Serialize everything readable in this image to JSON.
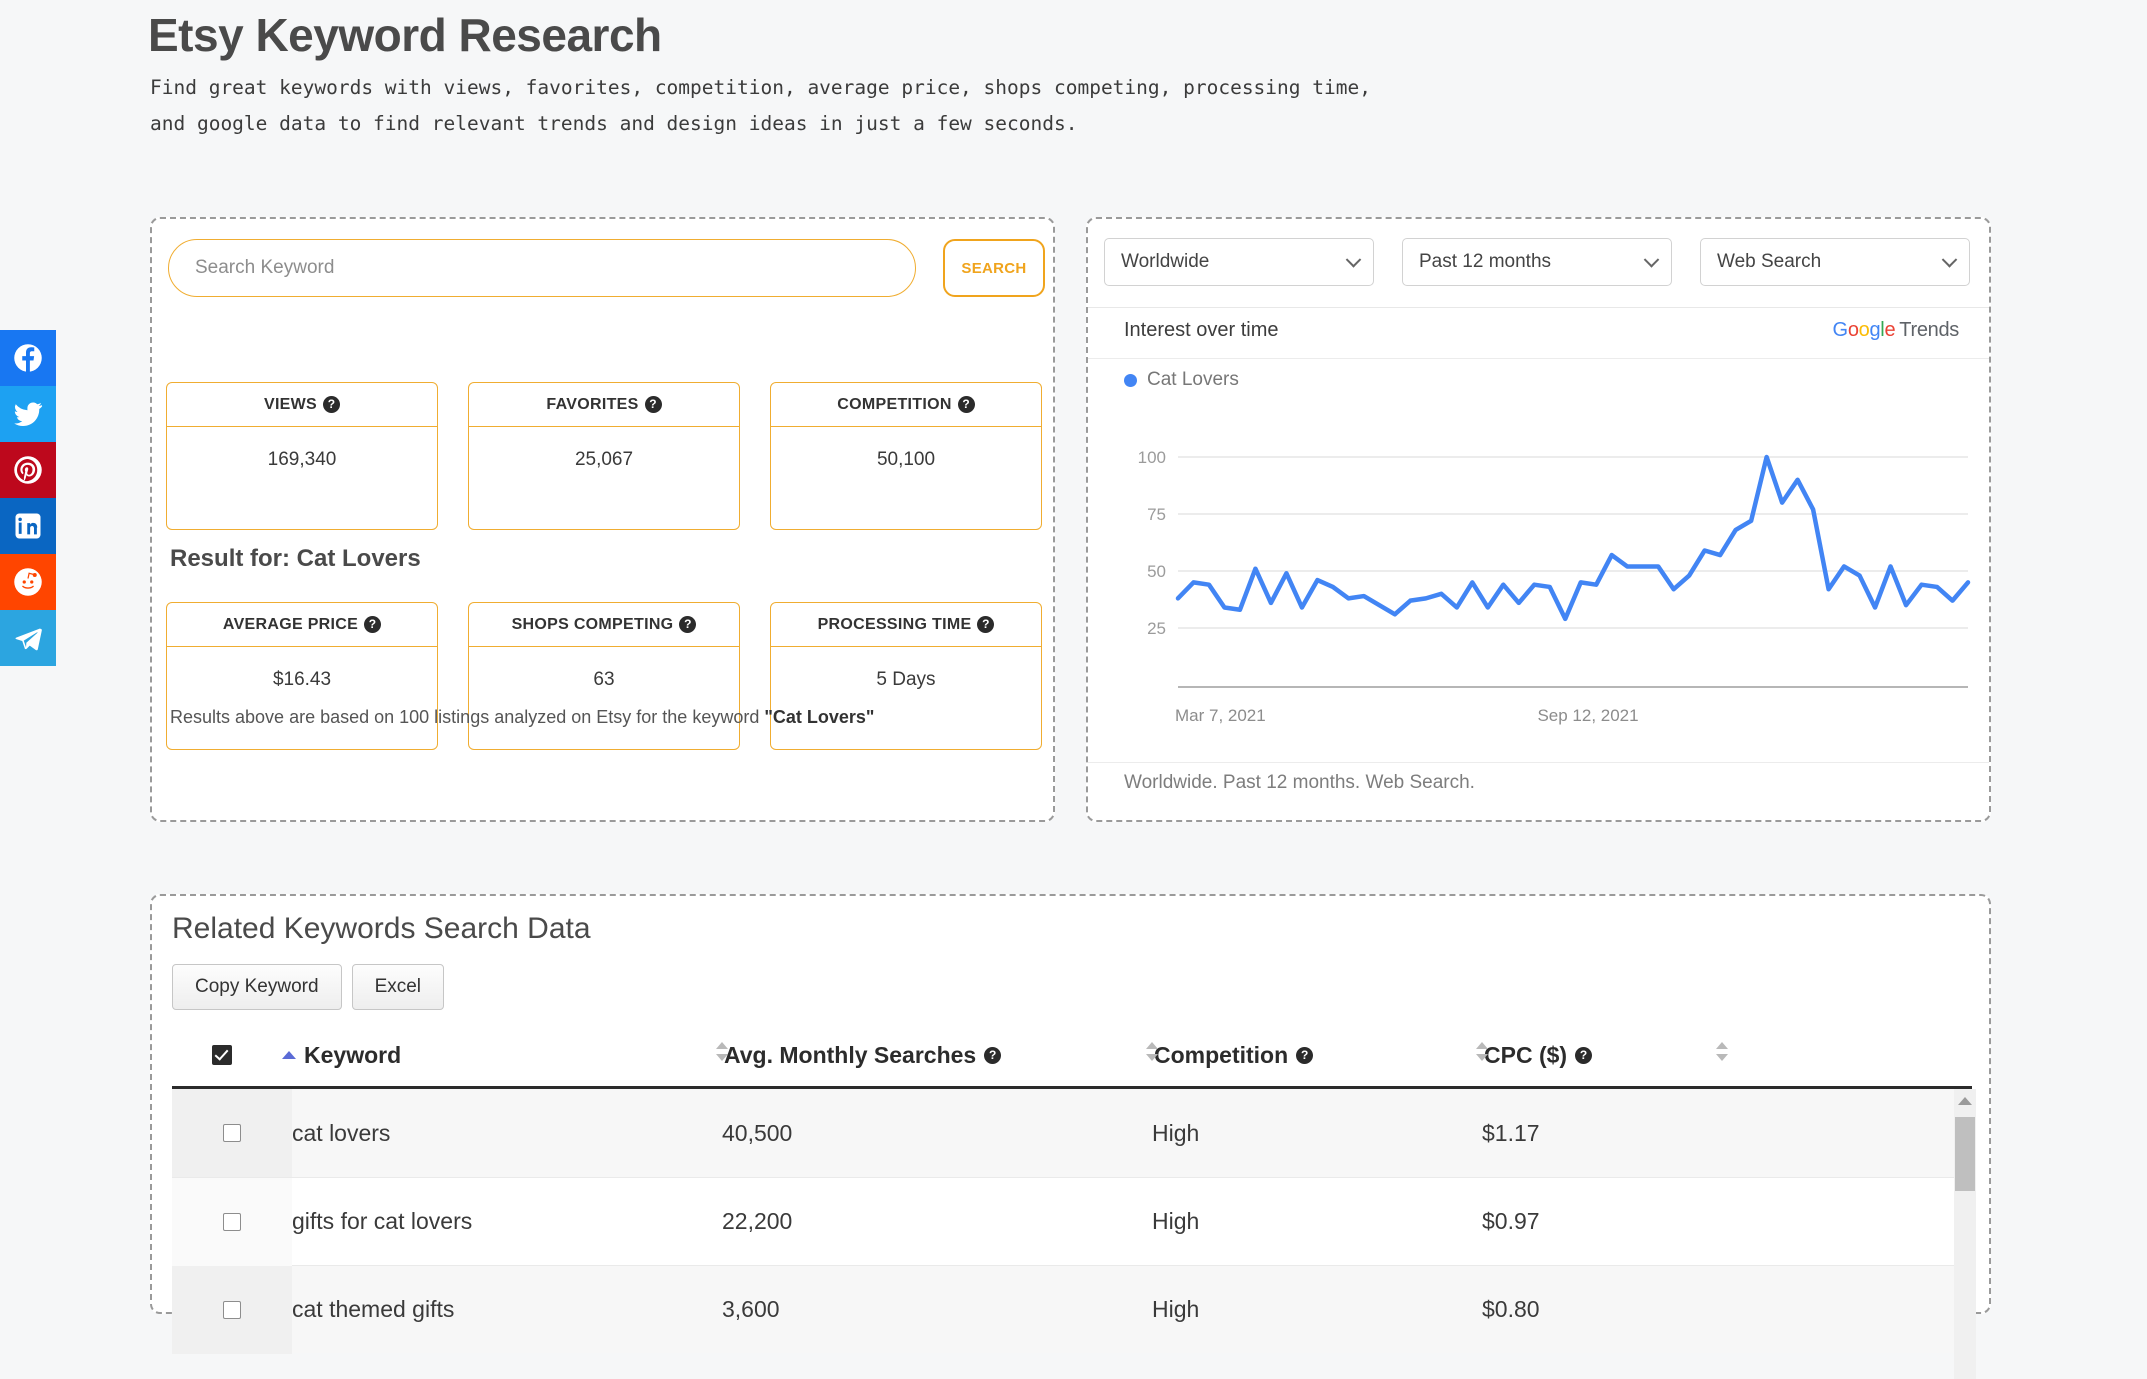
{
  "header": {
    "title": "Etsy Keyword Research",
    "description": "Find great keywords with views, favorites, competition, average price, shops competing, processing time, and google data to find relevant trends and design ideas in just a few seconds."
  },
  "social": {
    "items": [
      {
        "name": "facebook",
        "color": "#1877F2"
      },
      {
        "name": "twitter",
        "color": "#1DA1F2"
      },
      {
        "name": "pinterest",
        "color": "#BD081C"
      },
      {
        "name": "linkedin",
        "color": "#0A66C2"
      },
      {
        "name": "reddit",
        "color": "#FF4500"
      },
      {
        "name": "telegram",
        "color": "#2CA5E0"
      }
    ]
  },
  "search": {
    "placeholder": "Search Keyword",
    "value": "",
    "button_label": "SEARCH"
  },
  "results": {
    "heading": "Result for: Cat Lovers",
    "note_prefix": "Results above are based on 100 listings analyzed on Etsy for the keyword ",
    "note_keyword": "\"Cat Lovers\"",
    "metrics": [
      {
        "label": "VIEWS",
        "value": "169,340",
        "help": "?"
      },
      {
        "label": "FAVORITES",
        "value": "25,067",
        "help": "?"
      },
      {
        "label": "COMPETITION",
        "value": "50,100",
        "help": "?"
      },
      {
        "label": "AVERAGE PRICE",
        "value": "$16.43",
        "help": "?"
      },
      {
        "label": "SHOPS COMPETING",
        "value": "63",
        "help": "?"
      },
      {
        "label": "PROCESSING TIME",
        "value": "5 Days",
        "help": "?"
      }
    ]
  },
  "trends": {
    "selects": [
      {
        "name": "region",
        "value": "Worldwide"
      },
      {
        "name": "timeframe",
        "value": "Past 12 months"
      },
      {
        "name": "search-type",
        "value": "Web Search"
      }
    ],
    "section_label": "Interest over time",
    "logo": {
      "g1": "G",
      "o1": "o",
      "o2": "o",
      "g2": "g",
      "l": "l",
      "e": "e",
      "word": "Trends"
    },
    "footer": "Worldwide. Past 12 months. Web Search.",
    "accent_color": "#4285f4"
  },
  "chart_data": {
    "type": "line",
    "title": "Interest over time",
    "legend": [
      "Cat Lovers"
    ],
    "legend_position": "top-left",
    "series": [
      {
        "name": "Cat Lovers",
        "values": [
          38,
          45,
          44,
          34,
          33,
          51,
          36,
          49,
          34,
          46,
          43,
          38,
          39,
          35,
          31,
          37,
          38,
          40,
          34,
          45,
          34,
          44,
          36,
          44,
          43,
          29,
          45,
          44,
          57,
          52,
          52,
          52,
          42,
          48,
          59,
          57,
          68,
          72,
          100,
          80,
          90,
          77,
          42,
          52,
          48,
          34,
          52,
          35,
          44,
          43,
          37,
          45
        ]
      }
    ],
    "x": [
      "Mar 7, 2021",
      "Sep 12, 2021"
    ],
    "xlabel": "",
    "ylabel": "",
    "yticks": [
      25,
      50,
      75,
      100
    ],
    "ylim": [
      0,
      105
    ],
    "grid": true,
    "line_color": "#4285f4"
  },
  "related": {
    "title": "Related Keywords Search Data",
    "buttons": [
      {
        "name": "copy-keyword",
        "label": "Copy Keyword"
      },
      {
        "name": "excel",
        "label": "Excel"
      }
    ],
    "columns": [
      {
        "key": "check",
        "label": "",
        "sort": "none"
      },
      {
        "key": "keyword",
        "label": "Keyword",
        "sort": "asc"
      },
      {
        "key": "searches",
        "label": "Avg. Monthly Searches",
        "help": "?",
        "sort": "both"
      },
      {
        "key": "competition",
        "label": "Competition",
        "help": "?",
        "sort": "both"
      },
      {
        "key": "cpc",
        "label": "CPC ($)",
        "help": "?",
        "sort": "both"
      }
    ],
    "rows": [
      {
        "keyword": "cat lovers",
        "searches": "40,500",
        "competition": "High",
        "cpc": "$1.17",
        "checked": false
      },
      {
        "keyword": "gifts for cat lovers",
        "searches": "22,200",
        "competition": "High",
        "cpc": "$0.97",
        "checked": false
      },
      {
        "keyword": "cat themed gifts",
        "searches": "3,600",
        "competition": "High",
        "cpc": "$0.80",
        "checked": false
      }
    ]
  }
}
